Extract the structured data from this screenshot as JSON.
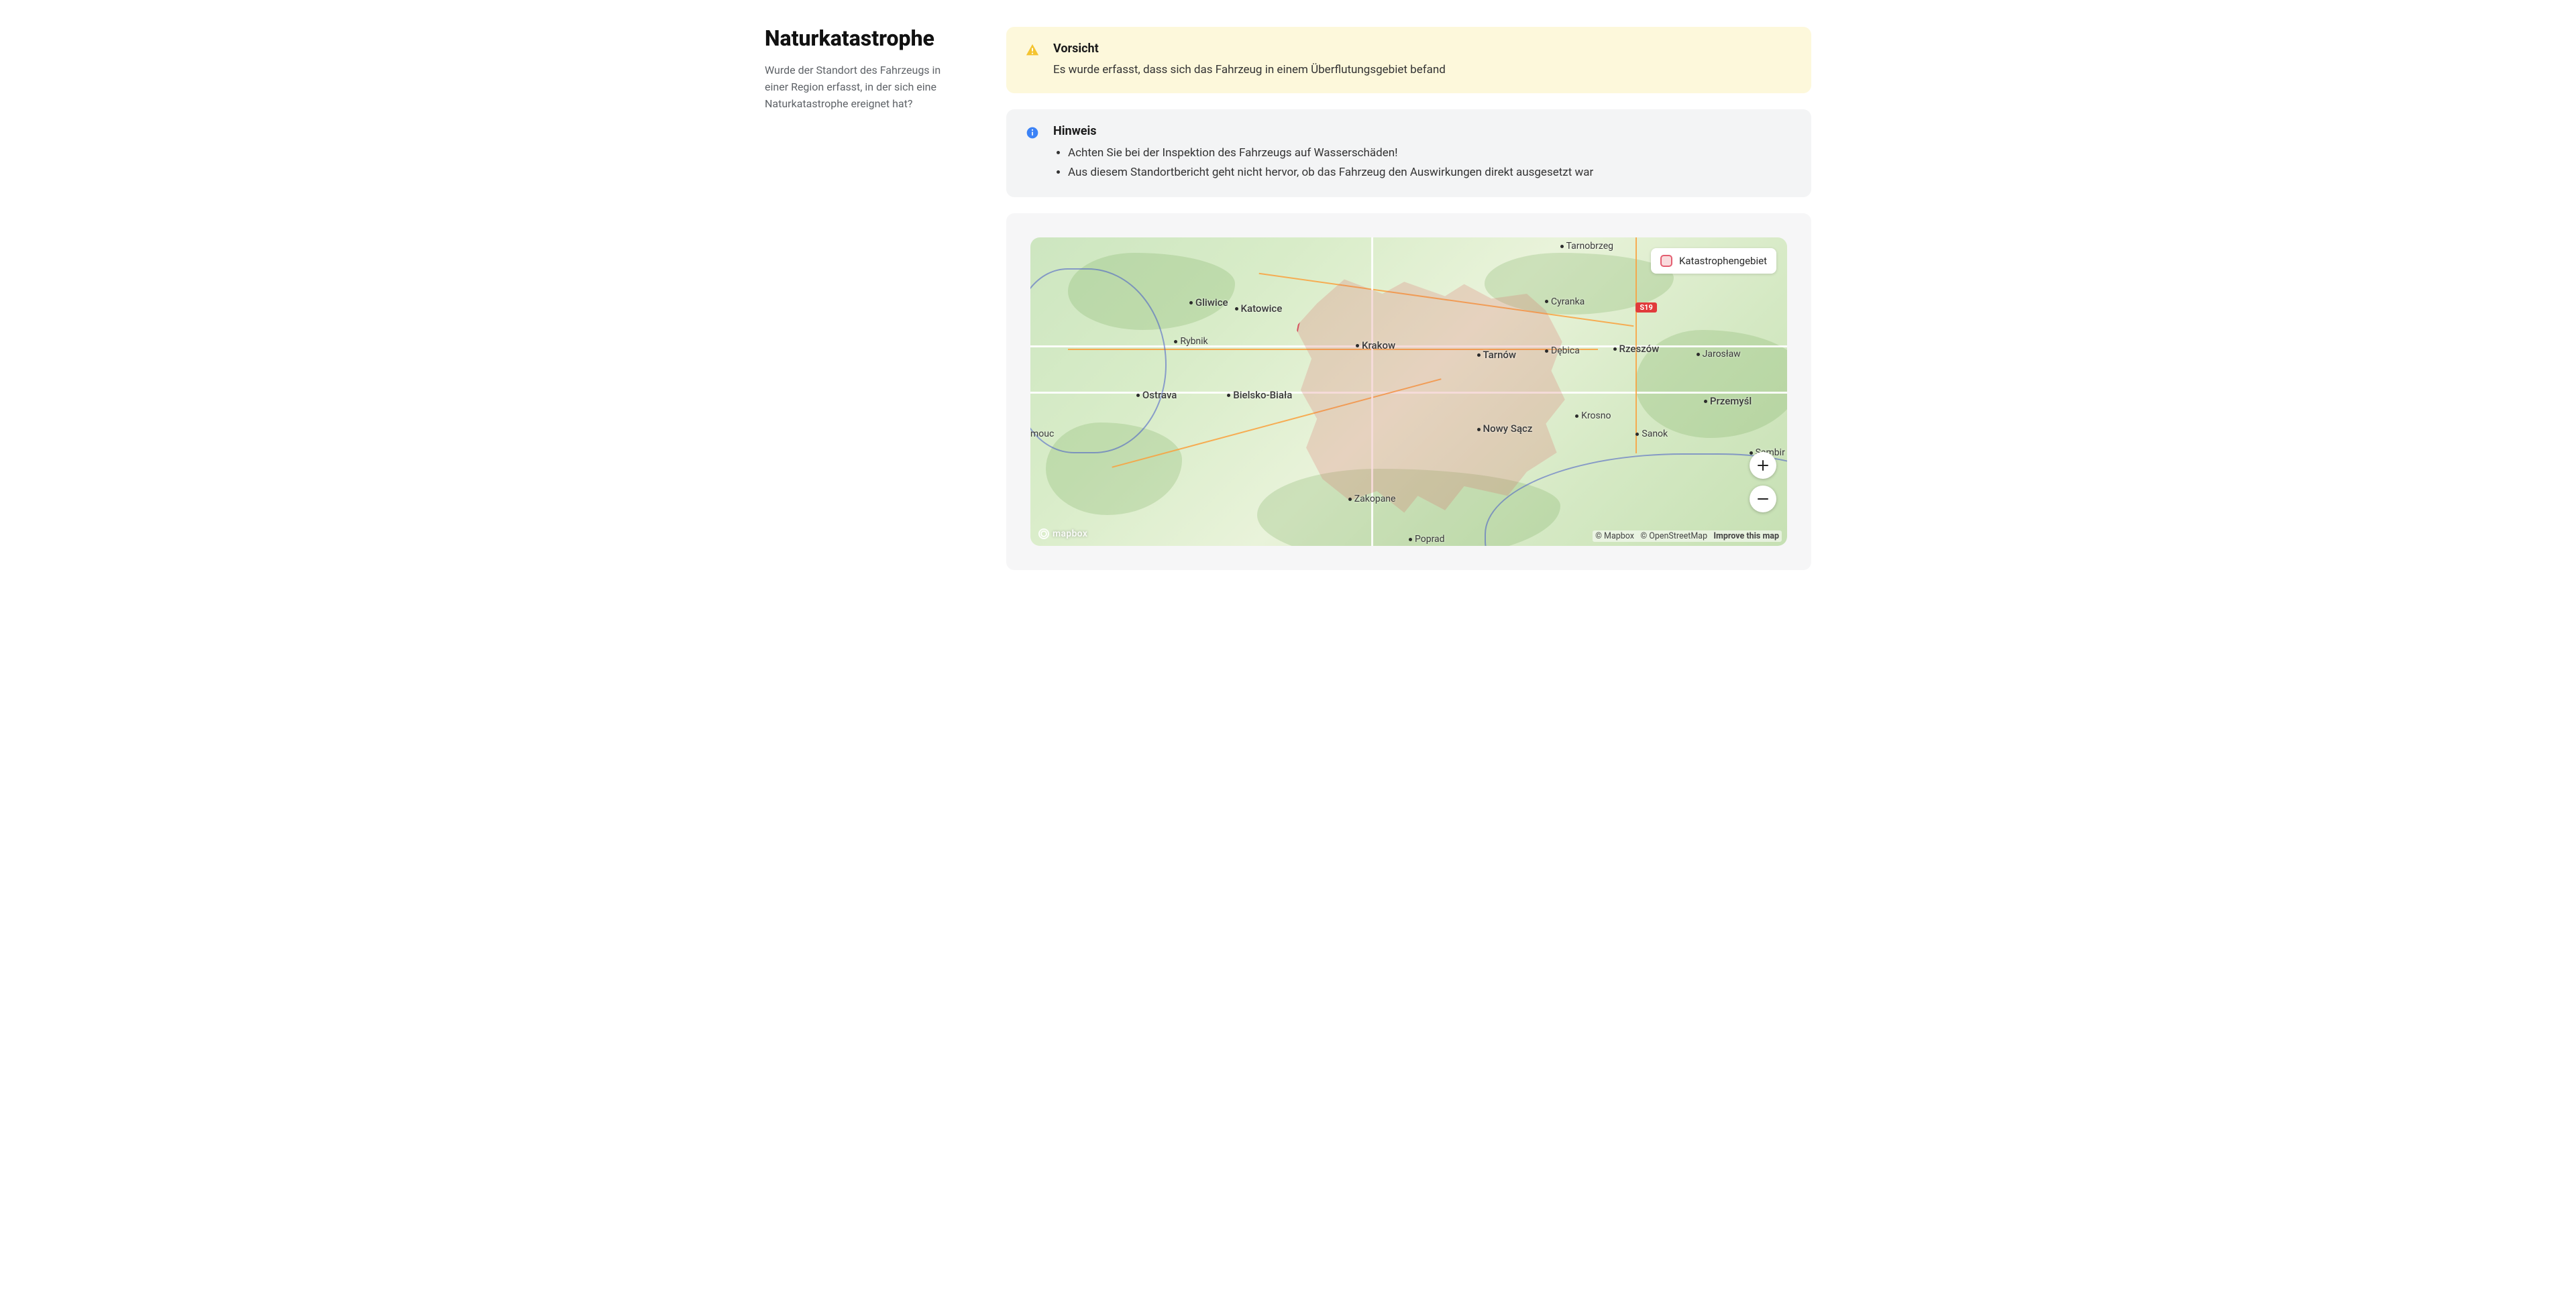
{
  "sidebar": {
    "title": "Naturkatastrophe",
    "description": "Wurde der Standort des Fahrzeugs in einer Region erfasst, in der sich eine Naturkatastrophe ereignet hat?"
  },
  "alert_warning": {
    "title": "Vorsicht",
    "text": "Es wurde erfasst, dass sich das Fahrzeug in einem Überflutungsgebiet befand"
  },
  "alert_info": {
    "title": "Hinweis",
    "items": [
      "Achten Sie bei der Inspektion des Fahrzeugs auf Wasserschäden!",
      "Aus diesem Standortbericht geht nicht hervor, ob das Fahrzeug den Auswirkungen direkt ausgesetzt war"
    ]
  },
  "map": {
    "legend_label": "Katastrophengebiet",
    "road_badge": "S19",
    "logo_text": "mapbox",
    "attribution": {
      "mapbox": "© Mapbox",
      "osm": "© OpenStreetMap",
      "improve": "Improve this map"
    },
    "cities": {
      "tarnobrzeg": "Tarnobrzeg",
      "gliwice": "Gliwice",
      "katowice": "Katowice",
      "cyranka": "Cyranka",
      "rybnik": "Rybnik",
      "krakow": "Krakow",
      "tarnow": "Tarnów",
      "debica": "Dębica",
      "rzeszow": "Rzeszów",
      "jaroslaw": "Jarosław",
      "ostrava": "Ostrava",
      "bielsko": "Bielsko-Biała",
      "przemysl": "Przemyśl",
      "krosno": "Krosno",
      "sanok": "Sanok",
      "nowysacz": "Nowy Sącz",
      "sambir": "Sambir",
      "mouc": "mouc",
      "zakopane": "Zakopane",
      "poprad": "Poprad"
    }
  },
  "colors": {
    "warning_bg": "#fdf8db",
    "info_bg": "#f3f4f5",
    "disaster_fill": "rgba(220,95,95,0.22)",
    "disaster_stroke": "rgba(210,60,80,0.85)"
  }
}
